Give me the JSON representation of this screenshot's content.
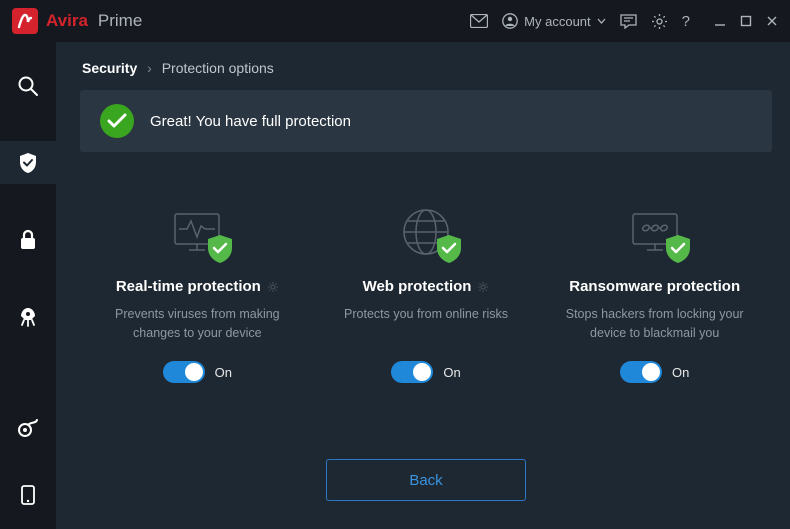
{
  "brand": {
    "name": "Avira",
    "edition": "Prime"
  },
  "titlebar": {
    "account_label": "My account"
  },
  "breadcrumb": {
    "section": "Security",
    "page": "Protection options"
  },
  "status": {
    "message": "Great! You have full protection"
  },
  "cards": {
    "realtime": {
      "title": "Real-time protection",
      "desc": "Prevents viruses from making changes to your device",
      "state_label": "On"
    },
    "web": {
      "title": "Web protection",
      "desc": "Protects you from online risks",
      "state_label": "On"
    },
    "ransomware": {
      "title": "Ransomware protection",
      "desc": "Stops hackers from locking your device to blackmail you",
      "state_label": "On"
    }
  },
  "footer": {
    "back_label": "Back"
  }
}
